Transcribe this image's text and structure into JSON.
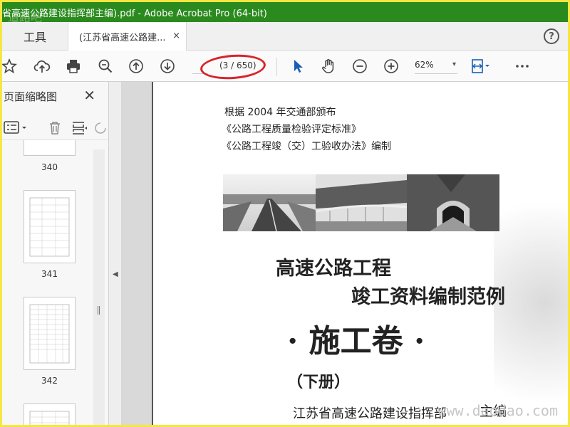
{
  "window": {
    "title": "省高速公路建设指挥部主编).pdf - Adobe Acrobat Pro (64-bit)",
    "title_watermark": "道路吧"
  },
  "tabs": {
    "tools_label": "工具",
    "doc_label": "(江苏省高速公路建...",
    "close_glyph": "×",
    "help_glyph": "?"
  },
  "toolbar": {
    "page_current": "",
    "page_count": "(3 / 650)",
    "zoom": "62%",
    "zoom_caret": "▾",
    "icons": [
      "star-icon",
      "cloud-upload-icon",
      "print-icon",
      "zoom-search-icon",
      "page-up-icon",
      "page-down-icon",
      "select-pointer-icon",
      "hand-tool-icon",
      "zoom-out-icon",
      "zoom-in-icon",
      "fit-page-icon",
      "more-icon"
    ]
  },
  "sidebar": {
    "title": "页面缩略图",
    "close_glyph": "✕",
    "thumbnails": [
      {
        "label": "340"
      },
      {
        "label": "341"
      },
      {
        "label": "342"
      }
    ]
  },
  "document": {
    "line1": "根据 2004 年交通部颁布",
    "line2": "《公路工程质量检验评定标准》",
    "line3": "《公路工程竣（交）工验收办法》编制",
    "title1": "高速公路工程",
    "title2": "竣工资料编制范例",
    "title3": "· 施工卷 ·",
    "title4": "（下册）",
    "editor": "江苏省高速公路建设指挥部",
    "editor_role": "主编"
  },
  "site_watermark": "www.daodao.com",
  "colors": {
    "title_bar": "#2b8a1e",
    "border": "#f5e642",
    "annotation": "#d9232a",
    "accent_blue": "#1a5fb4"
  }
}
